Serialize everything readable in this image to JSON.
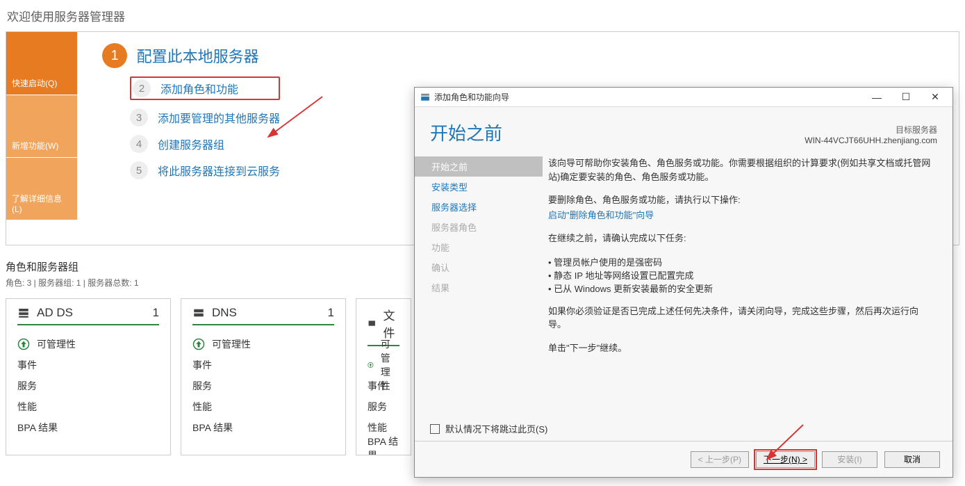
{
  "welcome": "欢迎使用服务器管理器",
  "tiles": {
    "quick": "快速启动(Q)",
    "new": "新增功能(W)",
    "learn": "了解详细信息(L)"
  },
  "steps": {
    "title": "配置此本地服务器",
    "s2": "添加角色和功能",
    "s3": "添加要管理的其他服务器",
    "s4": "创建服务器组",
    "s5": "将此服务器连接到云服务"
  },
  "roles": {
    "header": "角色和服务器组",
    "sub": "角色: 3 | 服务器组: 1 | 服务器总数: 1",
    "tiles": [
      {
        "name": "AD DS",
        "count": "1"
      },
      {
        "name": "DNS",
        "count": "1"
      },
      {
        "name": "文件",
        "count": ""
      }
    ],
    "lines": [
      "可管理性",
      "事件",
      "服务",
      "性能",
      "BPA 结果"
    ]
  },
  "wizard": {
    "title": "添加角色和功能向导",
    "heading": "开始之前",
    "target_label": "目标服务器",
    "target_server": "WIN-44VCJT66UHH.zhenjiang.com",
    "nav": [
      "开始之前",
      "安装类型",
      "服务器选择",
      "服务器角色",
      "功能",
      "确认",
      "结果"
    ],
    "p1": "该向导可帮助你安装角色、角色服务或功能。你需要根据组织的计算要求(例如共享文档或托管网站)确定要安装的角色、角色服务或功能。",
    "p2a": "要删除角色、角色服务或功能，请执行以下操作:",
    "p2link": "启动\"删除角色和功能\"向导",
    "p3": "在继续之前，请确认完成以下任务:",
    "li1": "管理员帐户使用的是强密码",
    "li2": "静态 IP 地址等网络设置已配置完成",
    "li3": "已从 Windows 更新安装最新的安全更新",
    "p4": "如果你必须验证是否已完成上述任何先决条件，请关闭向导，完成这些步骤，然后再次运行向导。",
    "p5": "单击\"下一步\"继续。",
    "skip": "默认情况下将跳过此页(S)",
    "btn_prev": "< 上一步(P)",
    "btn_next": "下一步(N) >",
    "btn_install": "安装(I)",
    "btn_cancel": "取消"
  }
}
